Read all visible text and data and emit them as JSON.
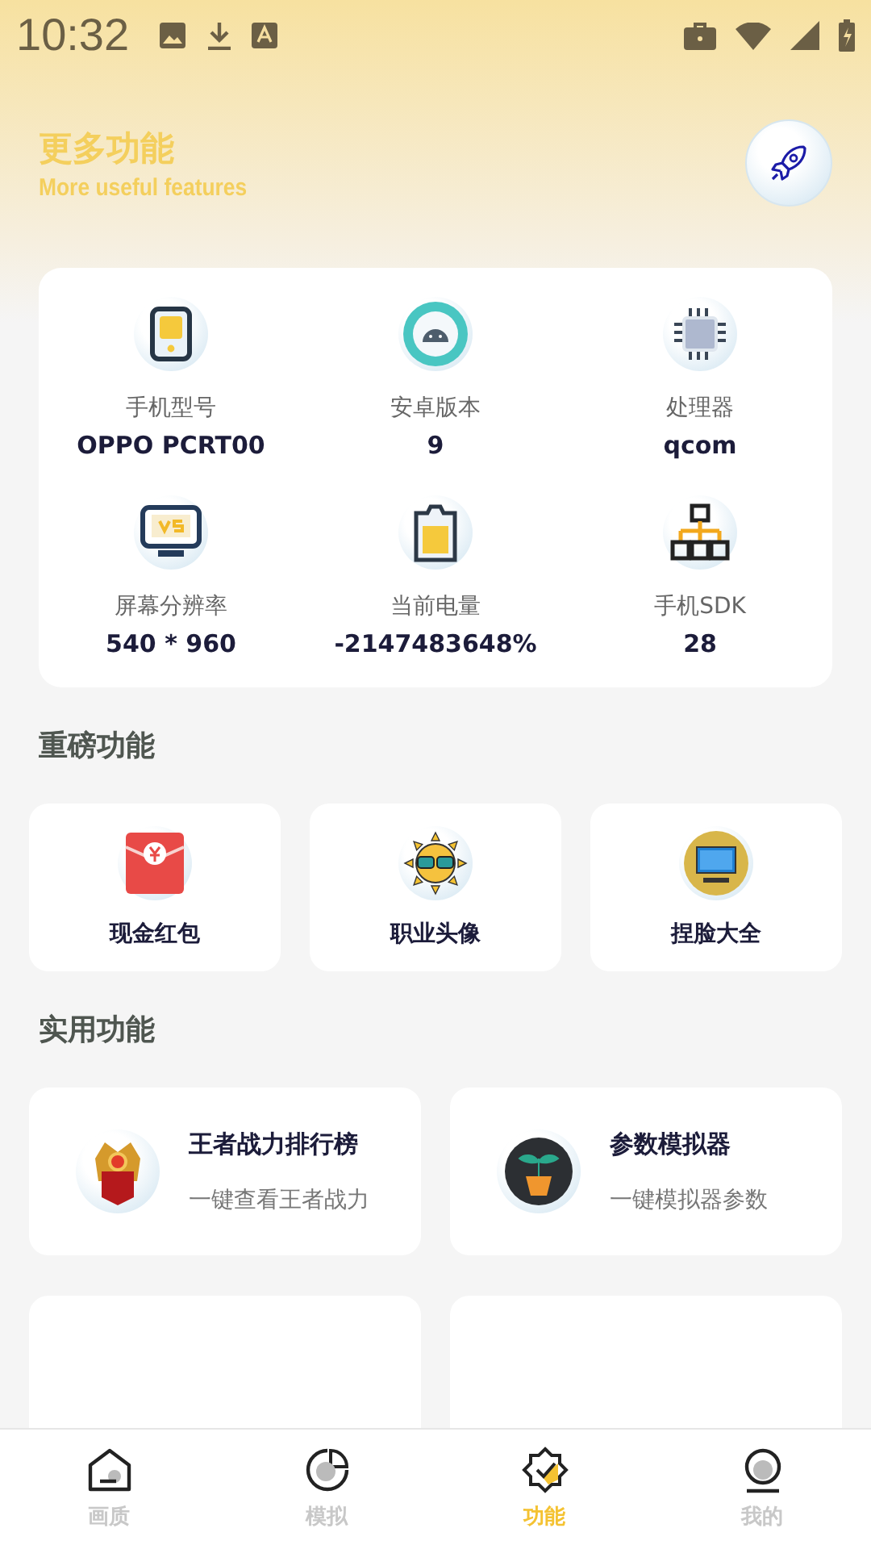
{
  "status_bar": {
    "time": "10:32"
  },
  "header": {
    "title": "更多功能",
    "subtitle": "More useful features"
  },
  "device_info": [
    {
      "label": "手机型号",
      "value": "OPPO PCRT00"
    },
    {
      "label": "安卓版本",
      "value": "9"
    },
    {
      "label": "处理器",
      "value": "qcom"
    },
    {
      "label": "屏幕分辨率",
      "value": "540 * 960"
    },
    {
      "label": "当前电量",
      "value": "-2147483648%"
    },
    {
      "label": "手机SDK",
      "value": "28"
    }
  ],
  "featured": {
    "title": "重磅功能",
    "items": [
      {
        "label": "现金红包"
      },
      {
        "label": "职业头像"
      },
      {
        "label": "捏脸大全"
      }
    ]
  },
  "tools": {
    "title": "实用功能",
    "items": [
      {
        "title": "王者战力排行榜",
        "subtitle": "一键查看王者战力"
      },
      {
        "title": "参数模拟器",
        "subtitle": "一键模拟器参数"
      }
    ]
  },
  "nav": [
    {
      "label": "画质",
      "selected": false
    },
    {
      "label": "模拟",
      "selected": false
    },
    {
      "label": "功能",
      "selected": true
    },
    {
      "label": "我的",
      "selected": false
    }
  ]
}
